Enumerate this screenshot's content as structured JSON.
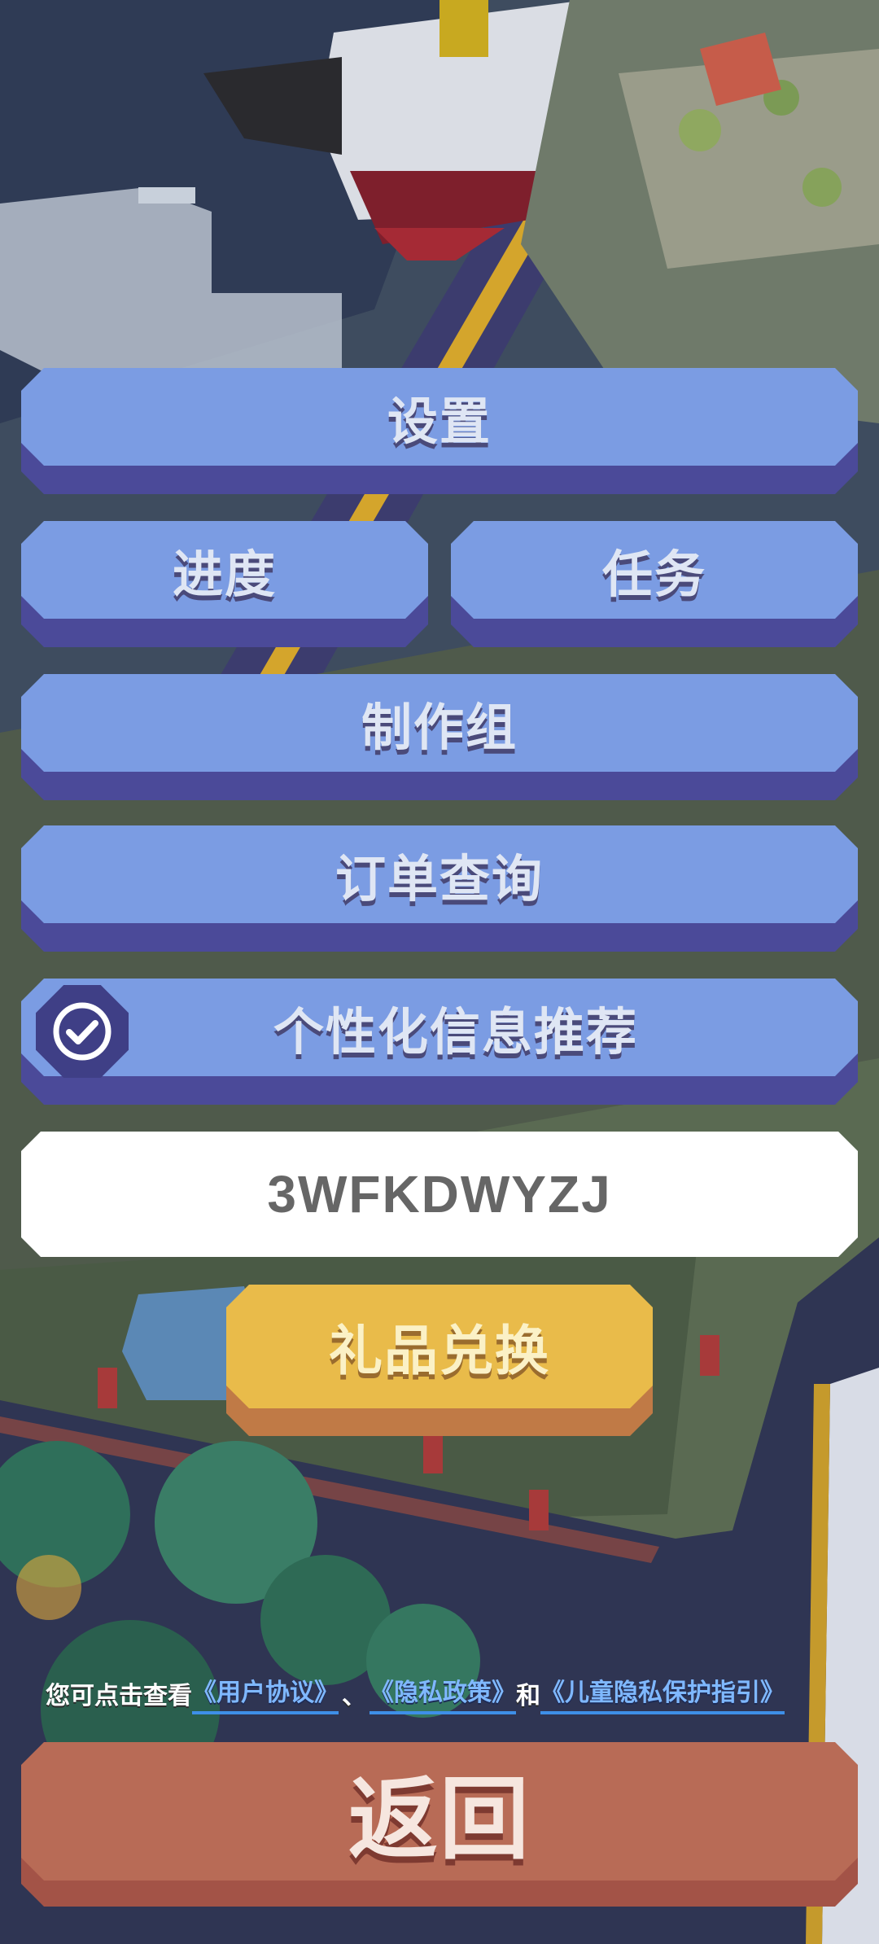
{
  "menu": {
    "settings_label": "设置",
    "progress_label": "进度",
    "tasks_label": "任务",
    "credits_label": "制作组",
    "orders_label": "订单查询",
    "personalized_label": "个性化信息推荐",
    "personalized_enabled": true
  },
  "redeem": {
    "code_value": "3WFKDWYZJ",
    "button_label": "礼品兑换"
  },
  "agreement": {
    "prefix": "您可点击查看",
    "user_agreement": "《用户协议》",
    "separator": "、",
    "privacy_policy": "《隐私政策》",
    "conjunction": "和",
    "child_privacy": "《儿童隐私保护指引》"
  },
  "back_label": "返回",
  "colors": {
    "button_blue": "#7b9ce3",
    "button_blue_shadow": "#4b4a99",
    "redeem_yellow": "#e9bb4a",
    "back_red": "#b86b56",
    "link_blue": "#7fb8ff"
  }
}
